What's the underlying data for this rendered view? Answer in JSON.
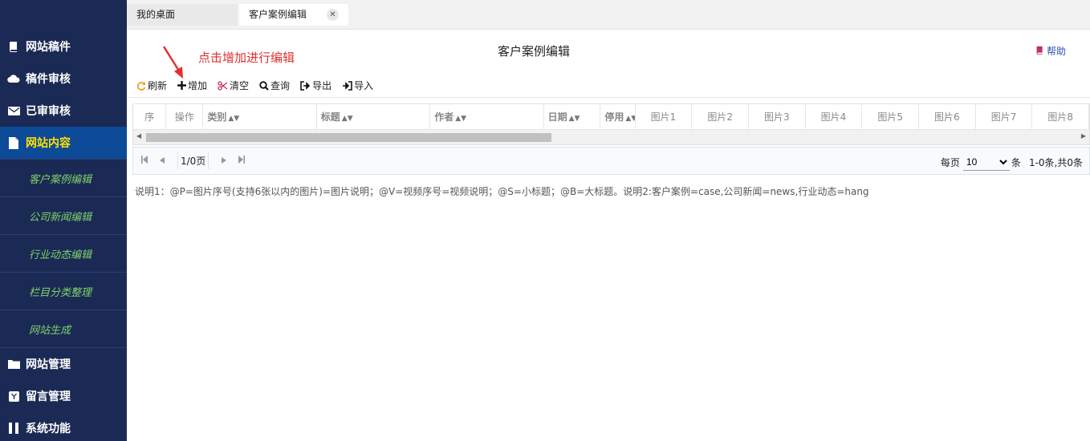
{
  "sidebar": {
    "items": [
      {
        "label": "网站稿件",
        "icon": "book-icon"
      },
      {
        "label": "稿件审核",
        "icon": "cloud-icon"
      },
      {
        "label": "已审审核",
        "icon": "envelope-icon"
      },
      {
        "label": "网站内容",
        "icon": "file-icon",
        "active": true
      },
      {
        "label": "网站管理",
        "icon": "folder-icon"
      },
      {
        "label": "留言管理",
        "icon": "message-icon"
      },
      {
        "label": "系统功能",
        "icon": "pause-icon"
      }
    ],
    "sub_items": [
      "客户案例编辑",
      "公司新闻编辑",
      "行业动态编辑",
      "栏目分类整理",
      "网站生成"
    ]
  },
  "tabs": [
    {
      "label": "我的桌面"
    },
    {
      "label": "客户案例编辑",
      "close": "✕"
    }
  ],
  "page": {
    "title": "客户案例编辑",
    "help_label": "帮助",
    "annotation": "点击增加进行编辑"
  },
  "toolbar": {
    "refresh": "刷新",
    "add": "增加",
    "clear": "清空",
    "query": "查询",
    "export": "导出",
    "import": "导入"
  },
  "table": {
    "columns": [
      "序",
      "操作",
      "类别",
      "标题",
      "作者",
      "日期",
      "停用",
      "图片1",
      "图片2",
      "图片3",
      "图片4",
      "图片5",
      "图片6",
      "图片7",
      "图片8"
    ]
  },
  "pager": {
    "page_info": "1/0页",
    "per_page_label": "每页",
    "per_page_value": "10",
    "unit": "条",
    "total": "1-0条,共0条"
  },
  "note": "说明1：@P=图片序号(支持6张以内的图片)=图片说明；@V=视频序号=视频说明；@S=小标题；@B=大标题。说明2:客户案例=case,公司新闻=news,行业动态=hang",
  "colors": {
    "sidebar_bg": "#1b2a55",
    "active_bg": "#0d4a98",
    "active_text": "#ffe100",
    "sub_text": "#7fd26a",
    "annotation": "#e0302f"
  }
}
